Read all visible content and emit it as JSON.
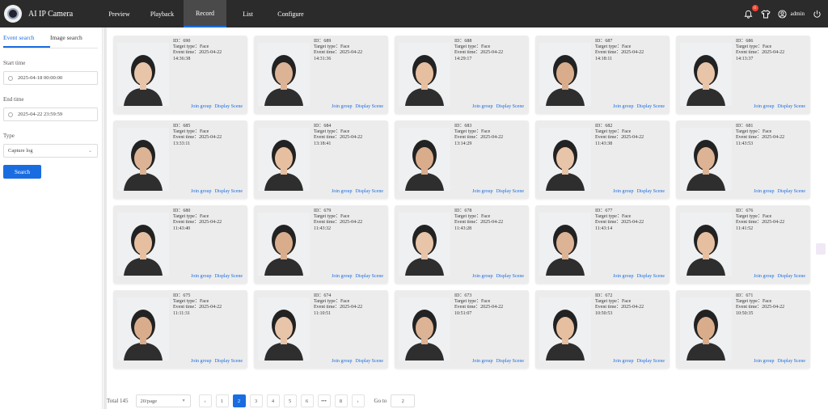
{
  "app": {
    "title": "AI IP Camera"
  },
  "nav": [
    {
      "label": "Preview",
      "active": false
    },
    {
      "label": "Playback",
      "active": false
    },
    {
      "label": "Record",
      "active": true
    },
    {
      "label": "List",
      "active": false
    },
    {
      "label": "Configure",
      "active": false
    }
  ],
  "header": {
    "notifications": "0",
    "user": "admin"
  },
  "sidebar": {
    "tabs": [
      {
        "label": "Event search",
        "active": true
      },
      {
        "label": "Image search",
        "active": false
      }
    ],
    "start_label": "Start time",
    "start_value": "2025-04-18 00:00:00",
    "end_label": "End time",
    "end_value": "2025-04-22 23:59:59",
    "type_label": "Type",
    "type_value": "Capture log",
    "search_label": "Search"
  },
  "labels": {
    "target": "Target type：",
    "event": "Event time：",
    "join": "Join group",
    "scene": "Display Scene",
    "id_prefix": "ID："
  },
  "cards": [
    {
      "id": "690",
      "type": "Face",
      "date": "2025-04-22",
      "time": "14:36:38"
    },
    {
      "id": "689",
      "type": "Face",
      "date": "2025-04-22",
      "time": "14:31:36"
    },
    {
      "id": "688",
      "type": "Face",
      "date": "2025-04-22",
      "time": "14:29:17"
    },
    {
      "id": "687",
      "type": "Face",
      "date": "2025-04-22",
      "time": "14:18:11"
    },
    {
      "id": "686",
      "type": "Face",
      "date": "2025-04-22",
      "time": "14:13:37"
    },
    {
      "id": "685",
      "type": "Face",
      "date": "2025-04-22",
      "time": "13:33:11"
    },
    {
      "id": "684",
      "type": "Face",
      "date": "2025-04-22",
      "time": "13:18:41"
    },
    {
      "id": "683",
      "type": "Face",
      "date": "2025-04-22",
      "time": "13:14:29"
    },
    {
      "id": "682",
      "type": "Face",
      "date": "2025-04-22",
      "time": "11:43:38"
    },
    {
      "id": "681",
      "type": "Face",
      "date": "2025-04-22",
      "time": "11:43:53"
    },
    {
      "id": "680",
      "type": "Face",
      "date": "2025-04-22",
      "time": "11:43:40"
    },
    {
      "id": "679",
      "type": "Face",
      "date": "2025-04-22",
      "time": "11:43:32"
    },
    {
      "id": "678",
      "type": "Face",
      "date": "2025-04-22",
      "time": "11:43:28"
    },
    {
      "id": "677",
      "type": "Face",
      "date": "2025-04-22",
      "time": "11:43:14"
    },
    {
      "id": "676",
      "type": "Face",
      "date": "2025-04-22",
      "time": "11:41:52"
    },
    {
      "id": "675",
      "type": "Face",
      "date": "2025-04-22",
      "time": "11:11:31"
    },
    {
      "id": "674",
      "type": "Face",
      "date": "2025-04-22",
      "time": "11:10:51"
    },
    {
      "id": "673",
      "type": "Face",
      "date": "2025-04-22",
      "time": "10:51:07"
    },
    {
      "id": "672",
      "type": "Face",
      "date": "2025-04-22",
      "time": "10:50:53"
    },
    {
      "id": "671",
      "type": "Face",
      "date": "2025-04-22",
      "time": "10:50:35"
    }
  ],
  "pagination": {
    "total": "Total 145",
    "page_size": "20/page",
    "pages": [
      "1",
      "2",
      "3",
      "4",
      "5",
      "6",
      "•••",
      "8"
    ],
    "current": "2",
    "goto_label": "Go to",
    "goto_value": "2",
    "prev": "‹",
    "next": "›"
  },
  "colors": {
    "accent": "#1a6de0",
    "topbar": "#2b2b2b"
  }
}
